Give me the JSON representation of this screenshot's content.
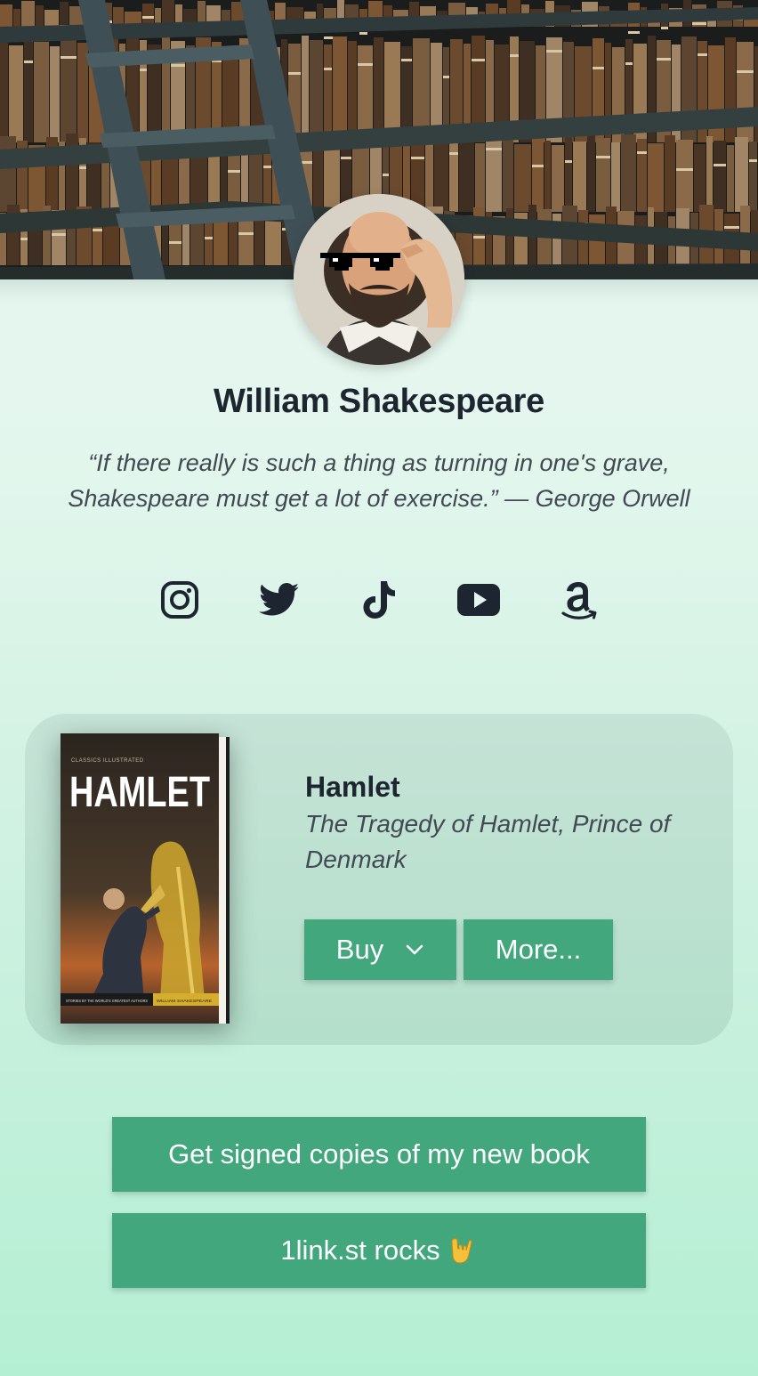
{
  "profile": {
    "name": "William Shakespeare",
    "quote": "“If there really is such a thing as turning in one's grave, Shakespeare must get a lot of exercise.” — George Orwell"
  },
  "socials": [
    {
      "icon": "instagram-icon"
    },
    {
      "icon": "twitter-icon"
    },
    {
      "icon": "tiktok-icon"
    },
    {
      "icon": "youtube-icon"
    },
    {
      "icon": "amazon-icon"
    }
  ],
  "book": {
    "title": "Hamlet",
    "subtitle": "The Tragedy of Hamlet, Prince of Denmark",
    "cover_title": "HAMLET",
    "cover_series": "CLASSICS ILLUSTRATED",
    "cover_footer_left": "STORIES BY THE WORLD'S GREATEST AUTHORS",
    "cover_footer_right": "WILLIAM SHAKESPEARE",
    "buy_label": "Buy",
    "more_label": "More..."
  },
  "links": [
    {
      "label": "Get signed copies of my new book"
    },
    {
      "label": "1link.st rocks",
      "emoji": "rock-hand-icon"
    }
  ],
  "colors": {
    "accent": "#43a77d",
    "text": "#1d2530",
    "muted": "#414a52",
    "card": "#bfe1d2",
    "background_top": "#eaf7f1",
    "background_bottom": "#b4efd3"
  }
}
